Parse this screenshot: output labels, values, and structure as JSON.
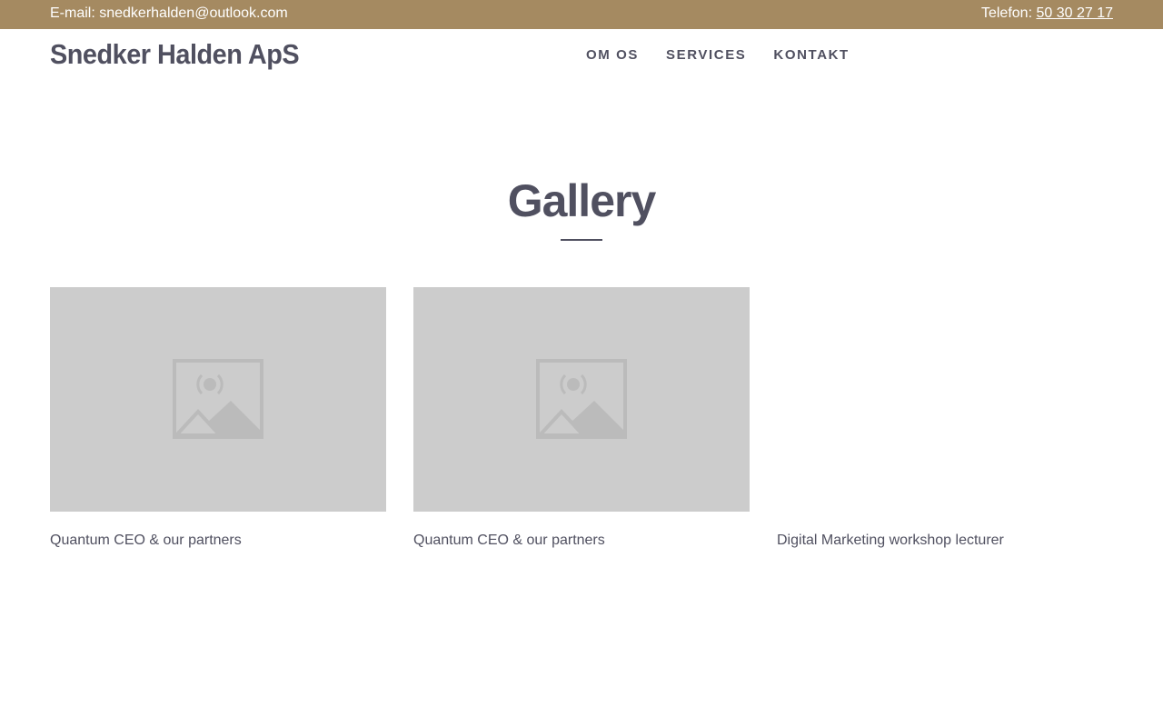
{
  "topbar": {
    "email_text": "E-mail: snedkerhalden@outlook.com",
    "phone_label": "Telefon:",
    "phone_number": "50 30 27 17"
  },
  "header": {
    "logo": "Snedker Halden ApS",
    "nav": [
      {
        "label": "OM OS"
      },
      {
        "label": "SERVICES"
      },
      {
        "label": "KONTAKT"
      }
    ]
  },
  "gallery": {
    "title": "Gallery",
    "items": [
      {
        "caption": "Quantum CEO & our partners",
        "image": "placeholder-image-icon"
      },
      {
        "caption": "Quantum CEO & our partners",
        "image": "placeholder-image-icon"
      },
      {
        "caption": "Digital Marketing workshop lecturer",
        "image": ""
      }
    ]
  },
  "colors": {
    "topbar_bg": "#a58a61",
    "text": "#505060",
    "placeholder_bg": "#cccccc",
    "placeholder_icon": "#bbbbbb"
  }
}
